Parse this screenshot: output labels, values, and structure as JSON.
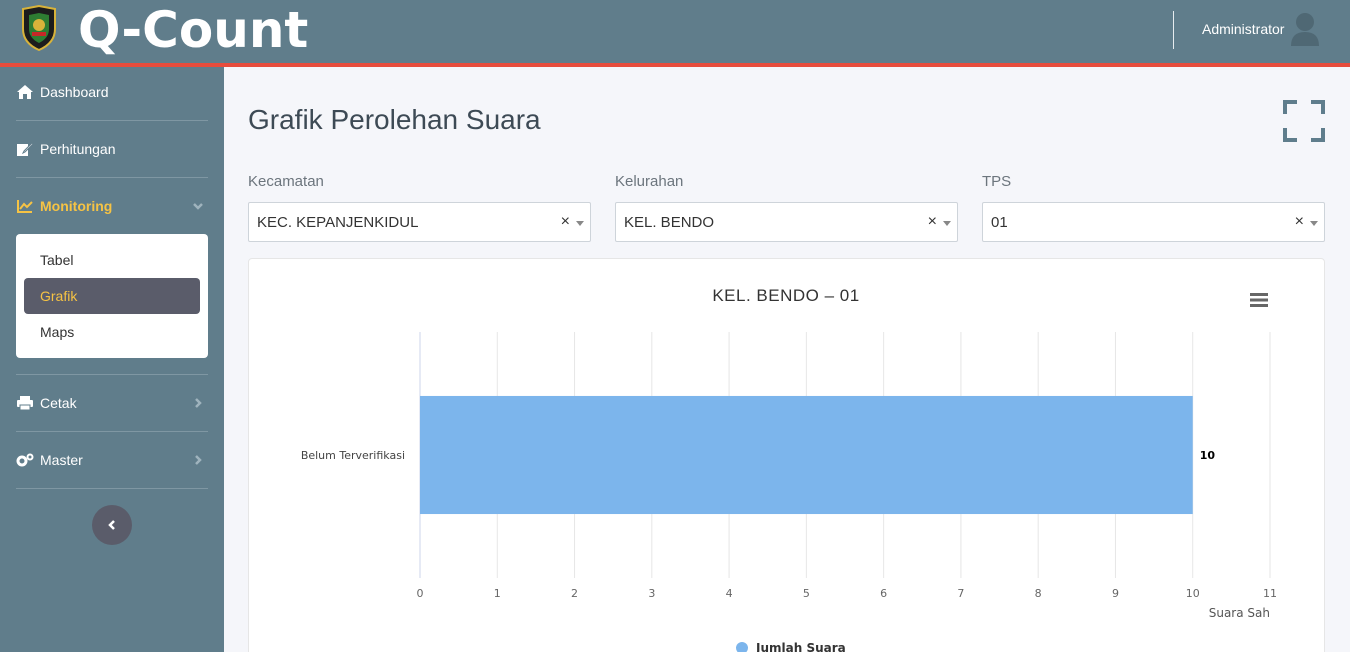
{
  "header": {
    "brand": "Q-Count",
    "user_name": "Administrator",
    "colors": {
      "bar": "#607d8b",
      "accent_line": "#e74c3c"
    }
  },
  "sidebar": {
    "items": [
      {
        "label": "Dashboard",
        "icon": "home-icon"
      },
      {
        "label": "Perhitungan",
        "icon": "edit-icon"
      },
      {
        "label": "Monitoring",
        "icon": "chart-line-icon",
        "active": true
      },
      {
        "label": "Cetak",
        "icon": "print-icon"
      },
      {
        "label": "Master",
        "icon": "cogs-icon"
      }
    ],
    "submenu": [
      {
        "label": "Tabel"
      },
      {
        "label": "Grafik",
        "active": true
      },
      {
        "label": "Maps"
      }
    ],
    "active_color": "#f6c344"
  },
  "main": {
    "page_title": "Grafik Perolehan Suara",
    "filters": {
      "kecamatan": {
        "label": "Kecamatan",
        "value": "KEC. KEPANJENKIDUL"
      },
      "kelurahan": {
        "label": "Kelurahan",
        "value": "KEL. BENDO"
      },
      "tps": {
        "label": "TPS",
        "value": "01"
      }
    },
    "clear_glyph": "×"
  },
  "chart_data": {
    "type": "bar",
    "orientation": "horizontal",
    "title": "KEL. BENDO – 01",
    "categories": [
      "Belum Terverifikasi"
    ],
    "series": [
      {
        "name": "Jumlah Suara",
        "values": [
          10
        ],
        "color": "#7cb5ec"
      }
    ],
    "xlabel": "Suara Sah",
    "xlim": [
      0,
      11
    ],
    "xticks": [
      0,
      1,
      2,
      3,
      4,
      5,
      6,
      7,
      8,
      9,
      10,
      11
    ],
    "data_labels": [
      "10"
    ],
    "grid": true,
    "legend": "bottom-center"
  }
}
